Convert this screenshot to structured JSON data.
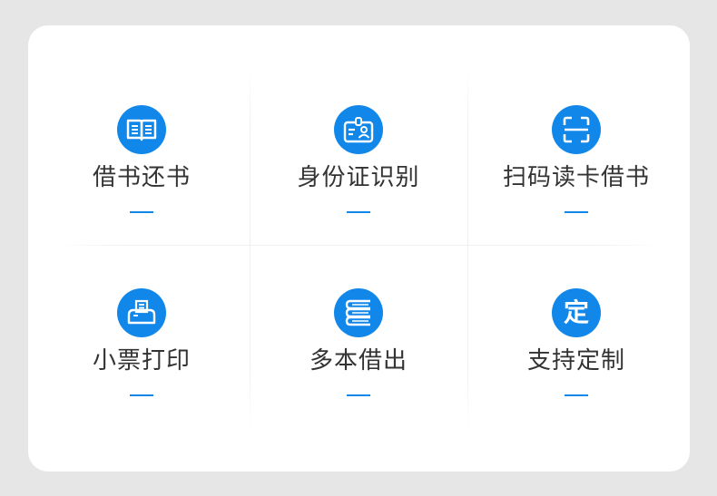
{
  "colors": {
    "accent": "#1187e9",
    "text": "#333333",
    "card": "#ffffff",
    "background": "#e6e6e6"
  },
  "features": [
    {
      "label": "借书还书",
      "icon": "open-book-icon"
    },
    {
      "label": "身份证识别",
      "icon": "id-card-icon"
    },
    {
      "label": "扫码读卡借书",
      "icon": "scan-frame-icon"
    },
    {
      "label": "小票打印",
      "icon": "printer-icon"
    },
    {
      "label": "多本借出",
      "icon": "book-stack-icon"
    },
    {
      "label": "支持定制",
      "icon": "custom-icon",
      "icon_text": "定"
    }
  ]
}
